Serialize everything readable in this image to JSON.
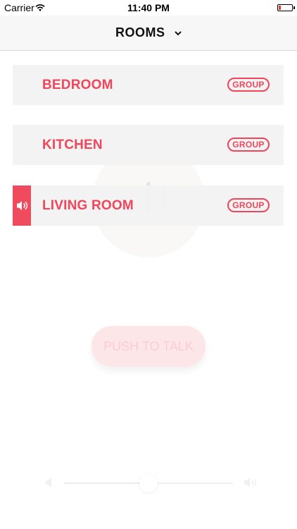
{
  "status_bar": {
    "carrier": "Carrier",
    "time": "11:40 PM"
  },
  "nav": {
    "title": "ROOMS"
  },
  "rooms": [
    {
      "name": "BEDROOM",
      "group_label": "GROUP",
      "active": false
    },
    {
      "name": "KITCHEN",
      "group_label": "GROUP",
      "active": false
    },
    {
      "name": "LIVING ROOM",
      "group_label": "GROUP",
      "active": true
    }
  ],
  "player": {
    "push_to_talk_label": "PUSH TO TALK",
    "volume_level": 0.5
  },
  "colors": {
    "accent": "#f0455a",
    "row_background": "#f2f2f3",
    "push_button": "#fde6e8"
  },
  "icons": [
    "wifi-icon",
    "battery-icon",
    "chevron-down-icon",
    "speaker-icon",
    "volume-low-icon",
    "volume-high-icon"
  ]
}
